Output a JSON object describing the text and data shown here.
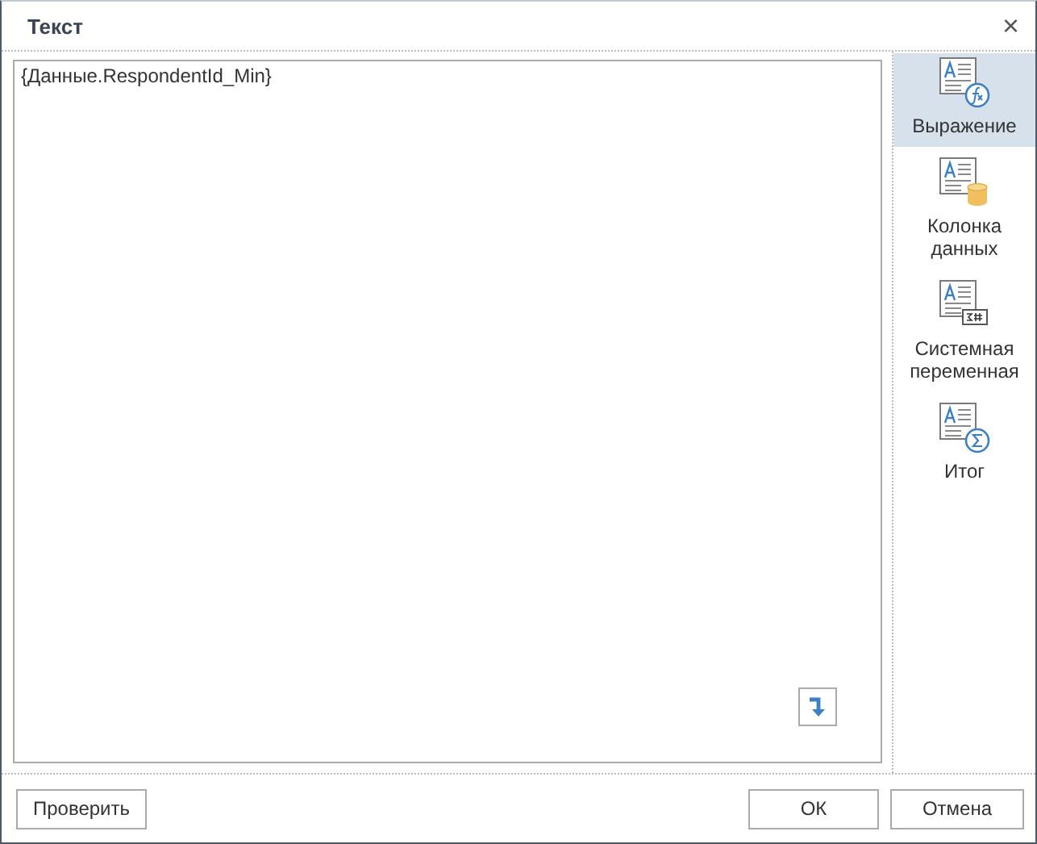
{
  "window": {
    "title": "Текст",
    "close": "×"
  },
  "editor": {
    "value": "{Данные.RespondentId_Min}"
  },
  "side_items": [
    {
      "kind": "expression",
      "label": "Выражение",
      "selected": true
    },
    {
      "kind": "column",
      "label": "Колонка данных",
      "selected": false
    },
    {
      "kind": "sysvar",
      "label": "Системная переменная",
      "selected": false
    },
    {
      "kind": "total",
      "label": "Итог",
      "selected": false
    }
  ],
  "buttons": [
    {
      "label": "Проверить"
    },
    {
      "label": "ОК"
    },
    {
      "label": "Отмена"
    }
  ]
}
